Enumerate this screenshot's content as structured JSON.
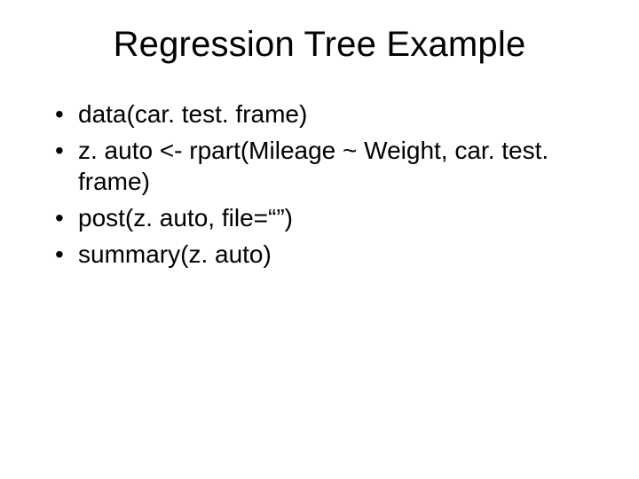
{
  "slide": {
    "title": "Regression Tree Example",
    "bullets": [
      "data(car. test. frame)",
      "z. auto <- rpart(Mileage ~ Weight, car. test. frame)",
      "post(z. auto, file=“”)",
      "summary(z. auto)"
    ]
  }
}
